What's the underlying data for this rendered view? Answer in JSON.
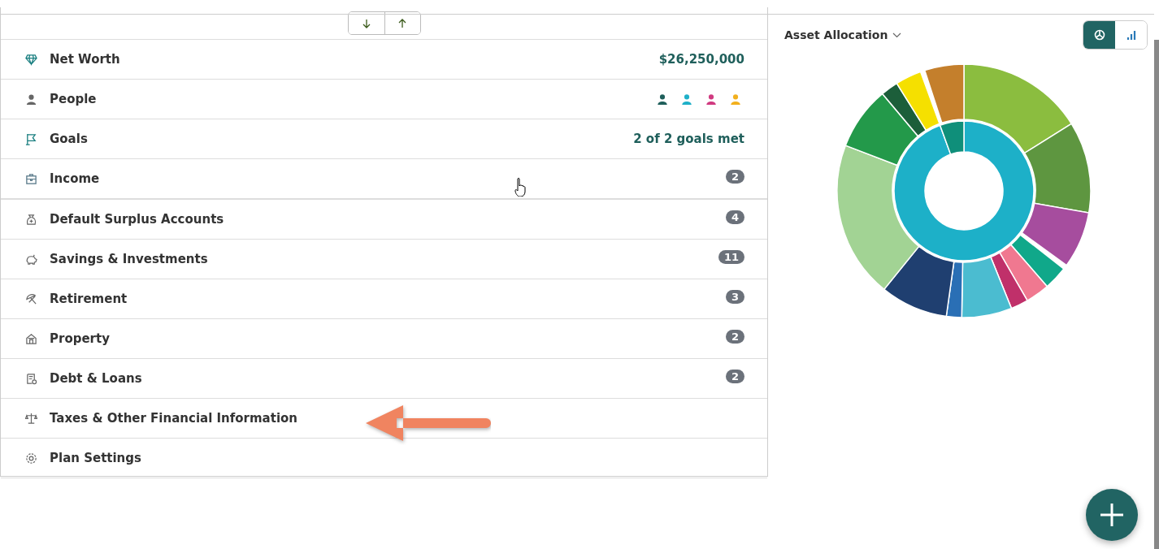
{
  "sort_buttons": [
    {
      "kind": "down"
    },
    {
      "kind": "up"
    }
  ],
  "rows": [
    {
      "label": "Net Worth",
      "kind": "value",
      "value": "$26,250,000"
    },
    {
      "label": "People",
      "kind": "people",
      "people": [
        {
          "color": "#1f5f5b"
        },
        {
          "color": "#1fb0c8"
        },
        {
          "color": "#d03a80"
        },
        {
          "color": "#f2b01e"
        }
      ]
    },
    {
      "label": "Goals",
      "kind": "value",
      "value": "2 of 2 goals met"
    },
    {
      "label": "Income",
      "kind": "badge",
      "badge": "2"
    },
    {
      "label": "Default Surplus Accounts",
      "kind": "badge",
      "badge": "4"
    },
    {
      "label": "Savings & Investments",
      "kind": "badge",
      "badge": "11"
    },
    {
      "label": "Retirement",
      "kind": "badge",
      "badge": "3"
    },
    {
      "label": "Property",
      "kind": "badge",
      "badge": "2"
    },
    {
      "label": "Debt & Loans",
      "kind": "badge",
      "badge": "2"
    },
    {
      "label": "Taxes & Other Financial Information",
      "kind": "none"
    },
    {
      "label": "Plan Settings",
      "kind": "none"
    }
  ],
  "chart_panel": {
    "title": "Asset Allocation",
    "views": [
      {
        "kind": "pie",
        "selected": true
      },
      {
        "kind": "bar",
        "selected": false
      }
    ]
  }
}
